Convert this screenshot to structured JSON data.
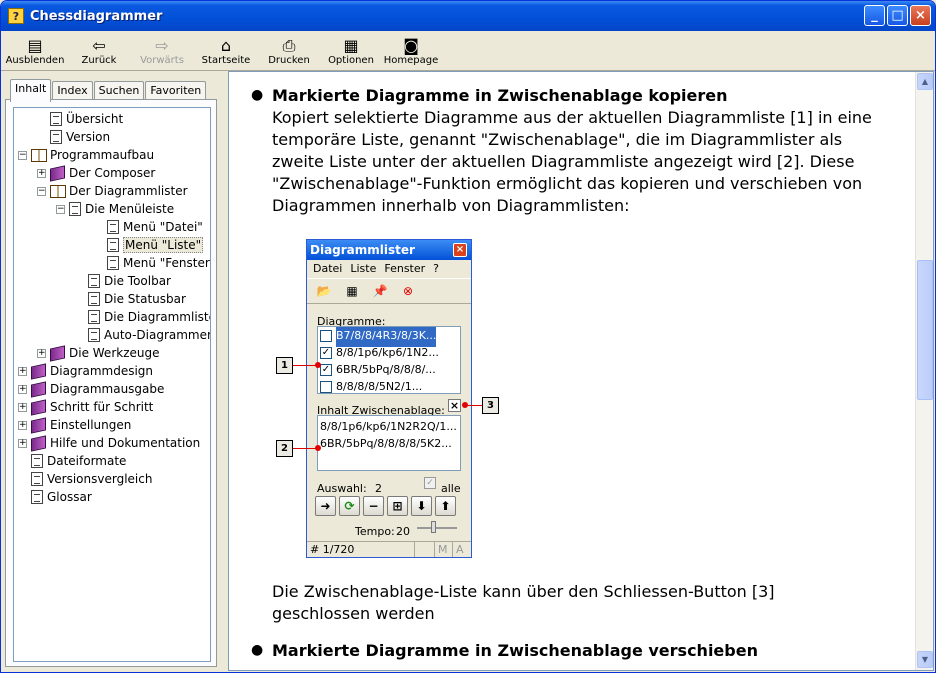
{
  "window": {
    "title": "Chessdiagrammer",
    "app_icon": "?"
  },
  "toolbar": {
    "items": [
      {
        "label": "Ausblenden",
        "icon": "hide-icon",
        "glyph": "▤",
        "enabled": true
      },
      {
        "label": "Zurück",
        "icon": "back-arrow-icon",
        "glyph": "⇦",
        "enabled": true
      },
      {
        "label": "Vorwärts",
        "icon": "forward-arrow-icon",
        "glyph": "⇨",
        "enabled": false
      },
      {
        "label": "Startseite",
        "icon": "home-icon",
        "glyph": "⌂",
        "enabled": true
      },
      {
        "label": "Drucken",
        "icon": "print-icon",
        "glyph": "⎙",
        "enabled": true
      },
      {
        "label": "Optionen",
        "icon": "options-icon",
        "glyph": "▦",
        "enabled": true
      },
      {
        "label": "Homepage",
        "icon": "homepage-icon",
        "glyph": "◙",
        "enabled": true
      }
    ]
  },
  "tabs": [
    {
      "label": "Inhalt",
      "active": true
    },
    {
      "label": "Index",
      "active": false
    },
    {
      "label": "Suchen",
      "active": false
    },
    {
      "label": "Favoriten",
      "active": false
    }
  ],
  "tree": [
    {
      "label": "Übersicht",
      "type": "page",
      "depth": 1,
      "expander": ""
    },
    {
      "label": "Version",
      "type": "page",
      "depth": 1,
      "expander": ""
    },
    {
      "label": "Programmaufbau",
      "type": "open-book",
      "depth": 0,
      "expander": "−"
    },
    {
      "label": "Der Composer",
      "type": "book",
      "depth": 1,
      "expander": "+"
    },
    {
      "label": "Der Diagrammlister",
      "type": "open-book",
      "depth": 1,
      "expander": "−"
    },
    {
      "label": "Die Menüleiste",
      "type": "page",
      "depth": 2,
      "expander": "−"
    },
    {
      "label": "Menü \"Datei\"",
      "type": "page",
      "depth": 4,
      "expander": ""
    },
    {
      "label": "Menü \"Liste\"",
      "type": "page",
      "depth": 4,
      "expander": "",
      "selected": true
    },
    {
      "label": "Menü \"Fenster\"",
      "type": "page",
      "depth": 4,
      "expander": ""
    },
    {
      "label": "Die Toolbar",
      "type": "page",
      "depth": 3,
      "expander": ""
    },
    {
      "label": "Die Statusbar",
      "type": "page",
      "depth": 3,
      "expander": ""
    },
    {
      "label": "Die Diagrammliste",
      "type": "page",
      "depth": 3,
      "expander": ""
    },
    {
      "label": "Auto-Diagrammer",
      "type": "page",
      "depth": 3,
      "expander": ""
    },
    {
      "label": "Die Werkzeuge",
      "type": "book",
      "depth": 1,
      "expander": "+"
    },
    {
      "label": "Diagrammdesign",
      "type": "book",
      "depth": 0,
      "expander": "+"
    },
    {
      "label": "Diagrammausgabe",
      "type": "book",
      "depth": 0,
      "expander": "+"
    },
    {
      "label": "Schritt für Schritt",
      "type": "book",
      "depth": 0,
      "expander": "+"
    },
    {
      "label": "Einstellungen",
      "type": "book",
      "depth": 0,
      "expander": "+"
    },
    {
      "label": "Hilfe und Dokumentation",
      "type": "book",
      "depth": 0,
      "expander": "+"
    },
    {
      "label": "Dateiformate",
      "type": "page",
      "depth": 0,
      "expander": ""
    },
    {
      "label": "Versionsvergleich",
      "type": "page",
      "depth": 0,
      "expander": ""
    },
    {
      "label": "Glossar",
      "type": "page",
      "depth": 0,
      "expander": ""
    }
  ],
  "content": {
    "section1_title": "Markierte Diagramme in Zwischenablage kopieren",
    "section1_lines": [
      "Kopiert selektierte Diagramme aus der aktuellen Diagrammliste [1] in eine",
      "temporäre Liste, genannt \"Zwischenablage\", die im Diagrammlister als",
      "zweite Liste unter der aktuellen Diagrammliste angezeigt wird [2]. Diese",
      "\"Zwischenablage\"-Funktion ermöglicht das kopieren und verschieben von",
      "Diagrammen innerhalb von Diagrammlisten:"
    ],
    "after_lines": [
      "Die Zwischenablage-Liste kann über den Schliessen-Button [3]",
      "geschlossen werden"
    ],
    "section2_title": "Markierte Diagramme in Zwischenablage verschieben"
  },
  "screenshot": {
    "title": "Diagrammlister",
    "menu": [
      "Datei",
      "Liste",
      "Fenster",
      "?"
    ],
    "diagrams_label": "Diagramme:",
    "diagrams": [
      {
        "text": "B7/8/8/4R3/8/3K...",
        "checked": false,
        "highlight": true
      },
      {
        "text": "8/8/1p6/kp6/1N2...",
        "checked": true,
        "highlight": false
      },
      {
        "text": "6BR/5bPq/8/8/8/...",
        "checked": true,
        "highlight": false
      },
      {
        "text": "8/8/8/8/5N2/1...",
        "checked": false,
        "highlight": false
      }
    ],
    "clipboard_label": "Inhalt Zwischenablage:",
    "clipboard_close": "×",
    "clipboard": [
      "8/8/1p6/kp6/1N2R2Q/1...",
      "6BR/5bPq/8/8/8/8/5K2..."
    ],
    "auswahl_label": "Auswahl:",
    "auswahl_value": "2",
    "alle_label": "alle",
    "tempo_label": "Tempo:",
    "tempo_value": "20",
    "status": [
      "# 1/720",
      "",
      "M",
      "A"
    ],
    "buttons": [
      "➜",
      "⟳",
      "−",
      "⊞",
      "⬇",
      "⬆"
    ]
  },
  "callouts": [
    "1",
    "2",
    "3"
  ]
}
